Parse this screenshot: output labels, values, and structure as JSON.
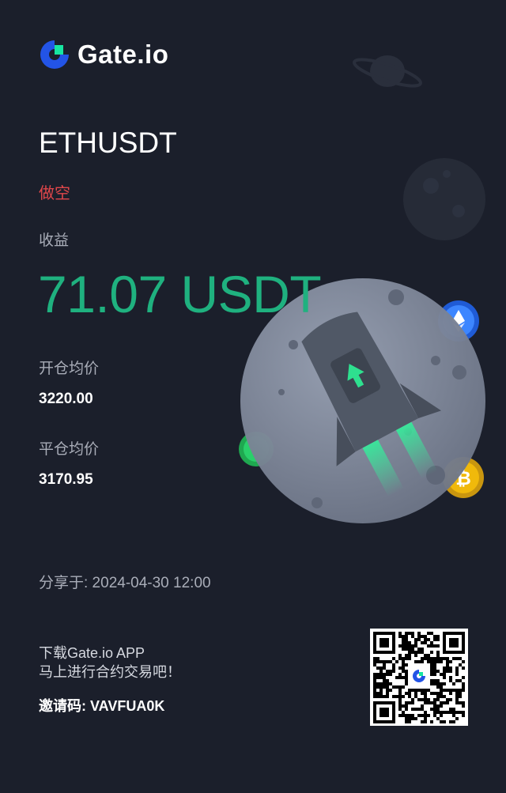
{
  "brand": {
    "name": "Gate.io",
    "logo_icon": "gate-logo-icon",
    "accent": "#2354e6",
    "accent_green": "#17e6a1"
  },
  "trade": {
    "pair": "ETHUSDT",
    "side": "做空",
    "side_color": "#e1474b",
    "profit_label": "收益",
    "profit_value": "71.07 USDT",
    "profit_color": "#1fb17f",
    "entry_label": "开仓均价",
    "entry_price": "3220.00",
    "exit_label": "平仓均价",
    "exit_price": "3170.95"
  },
  "share": {
    "text": "分享于: 2024-04-30 12:00"
  },
  "promo": {
    "line1": "下载Gate.io APP",
    "line2": "马上进行合约交易吧！",
    "invite": "邀请码: VAVFUA0K"
  },
  "illustration": {
    "name": "rocket-moon-illustration",
    "coins": [
      "eth-coin-icon",
      "btc-coin-icon",
      "green-coin-icon"
    ]
  },
  "qr": {
    "name": "qr-code"
  }
}
